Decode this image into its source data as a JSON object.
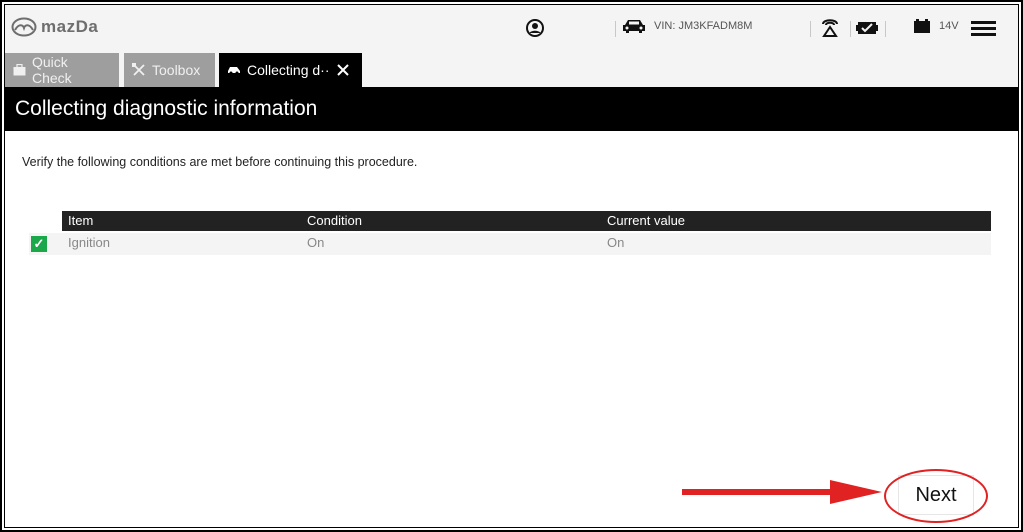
{
  "header": {
    "logo_text": "mazDa",
    "vin": "VIN: JM3KFADM8M",
    "voltage": "14V"
  },
  "tabs": [
    {
      "label": "Quick Check",
      "icon": "toolbox-case-icon",
      "active": false
    },
    {
      "label": "Toolbox",
      "icon": "tools-icon",
      "active": false
    },
    {
      "label": "Collecting d··",
      "icon": "car-icon",
      "active": true
    }
  ],
  "page": {
    "title": "Collecting diagnostic information",
    "instruction": "Verify the following conditions are met before continuing this procedure."
  },
  "table": {
    "headers": [
      "Item",
      "Condition",
      "Current value"
    ],
    "rows": [
      {
        "item": "Ignition",
        "condition": "On",
        "current": "On",
        "checked": true
      }
    ]
  },
  "actions": {
    "next_label": "Next"
  },
  "colors": {
    "title_band": "#000000",
    "tab_inactive": "#9e9e9e",
    "check_green": "#1aa84a",
    "highlight_red": "#e02222"
  }
}
